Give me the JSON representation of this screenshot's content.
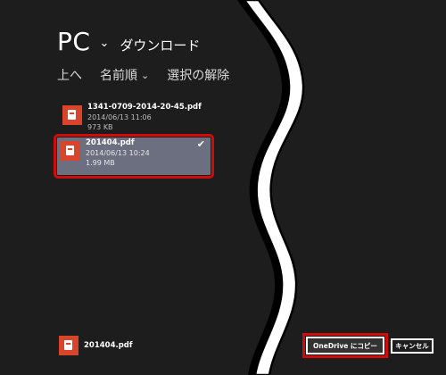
{
  "header": {
    "location": "PC",
    "folder": "ダウンロード"
  },
  "commands": {
    "up": "上へ",
    "sort": "名前順",
    "clear_selection": "選択の解除"
  },
  "files": [
    {
      "name": "1341-0709-2014-20-45.pdf",
      "date": "2014/06/13 11:06",
      "size": "973 KB",
      "selected": false
    },
    {
      "name": "201404.pdf",
      "date": "2014/06/13 10:24",
      "size": "1.99 MB",
      "selected": true
    }
  ],
  "basket": {
    "name": "201404.pdf"
  },
  "buttons": {
    "copy_onedrive": "OneDrive にコピー",
    "cancel": "キャンセル"
  },
  "icons": {
    "file": "pdf-file-icon",
    "check": "checkmark-icon",
    "chevron": "chevron-down-icon"
  },
  "colors": {
    "background": "#1d1d1d",
    "selected_bg": "#6b6f80",
    "highlight": "#d10a0a",
    "pdf_icon": "#d8452a"
  }
}
